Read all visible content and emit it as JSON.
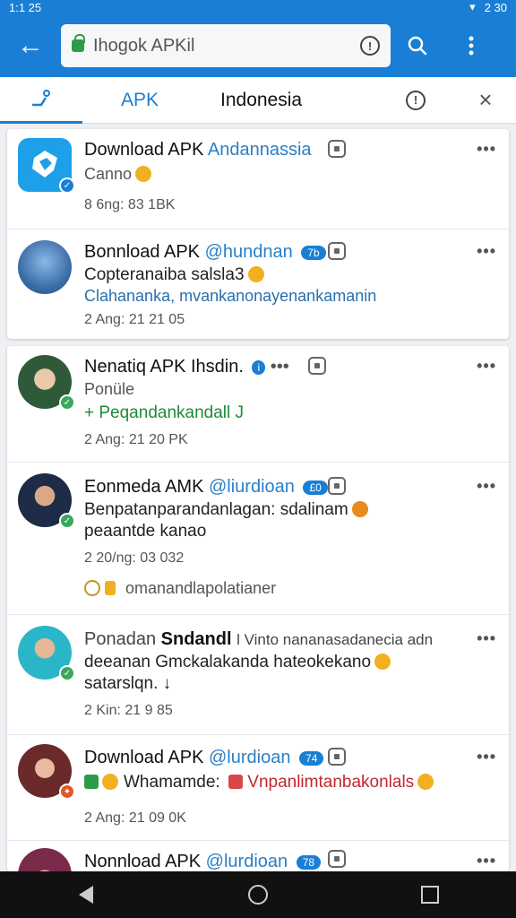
{
  "status": {
    "time": "1:1 25",
    "battery": "2 30"
  },
  "browser": {
    "url_text": "Ihogok APKil",
    "tabs": {
      "apk": "APK",
      "indonesia": "Indonesia"
    }
  },
  "colors": {
    "accent": "#1a7fd4",
    "link": "#2a7fc7",
    "green": "#1e8a3c",
    "verified": "#3aa85a"
  },
  "icons": [
    "back-arrow-icon",
    "lock-icon",
    "info-icon",
    "search-icon",
    "more-vert-icon",
    "home-tab-icon",
    "close-icon",
    "copy-icon",
    "more-horiz-icon"
  ],
  "feed": {
    "card1": [
      {
        "name": "Download APK",
        "handle": "Andannassia",
        "line1": "Canno",
        "meta": "8 6ng: 83 1BK"
      },
      {
        "name": "Bonnload APK",
        "handle": "@hundnan",
        "vbadge": "7b",
        "line1": "Copteranaiba salsla3",
        "line2": "Clahananka, mvankanonayenankamanin",
        "meta": "2 Ang: 21 21 05"
      }
    ],
    "card2": [
      {
        "name": "Nenatiq APK",
        "handle": "Ihsdin.",
        "line1": "Ponüle",
        "line2": "+ Peqandankandall J",
        "meta": "2 Ang: 21 20 PK"
      },
      {
        "name": "Eonmeda AMK",
        "handle": "@liurdioan",
        "vbadge": "£0",
        "line1": "Benpatanparandanlagan: sdalinam",
        "line2": "peaantde kanao",
        "meta": "2 20/ng: 03 032",
        "extra": "omanandlapolatianer"
      },
      {
        "name": "Ponadan",
        "bold": "Sndandl",
        "rest": "l Vinto nananasadanecia adn",
        "line1": "deeanan Gmckalakanda hateokekano",
        "line2": "satarslqn. ↓",
        "meta": "2 Kin: 21 9 85"
      },
      {
        "name": "Download APK",
        "handle": "@lurdioan",
        "vbadge": "74",
        "line1": "Whamamde:",
        "line1_red": "Vnpanlimtanbakonlals",
        "meta": "2 Ang: 21 09 0K"
      },
      {
        "name": "Nonnload APK",
        "handle": "@lurdioan",
        "vbadge": "78"
      }
    ]
  },
  "nav": {
    "back": "back",
    "home": "home",
    "recents": "recents"
  }
}
